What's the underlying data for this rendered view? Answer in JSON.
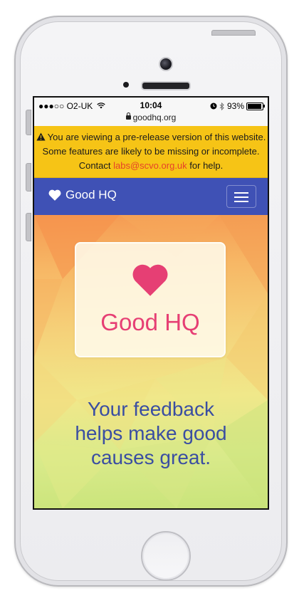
{
  "status_bar": {
    "carrier": "●●●○○ O2-UK",
    "time": "10:04",
    "battery": "93%",
    "url": "goodhq.org"
  },
  "banner": {
    "text_before": "You are viewing a pre-release version of this website. Some features are likely to be missing or incomplete. Contact",
    "link": "labs@scvo.org.uk",
    "text_after": "for help."
  },
  "navbar": {
    "brand": "Good HQ"
  },
  "hero": {
    "card_title": "Good HQ",
    "tagline_lines": [
      "Your feedback",
      "helps make good",
      "causes great."
    ]
  },
  "colors": {
    "navbar": "#3f51b5",
    "banner": "#f6c416",
    "brand_pink": "#e63f74",
    "tagline_blue": "#3a4ea2"
  },
  "icons": [
    "wifi-icon",
    "lock-icon",
    "alarm-icon",
    "bluetooth-icon",
    "battery-icon",
    "warning-icon",
    "heart-icon",
    "hamburger-menu-icon"
  ]
}
